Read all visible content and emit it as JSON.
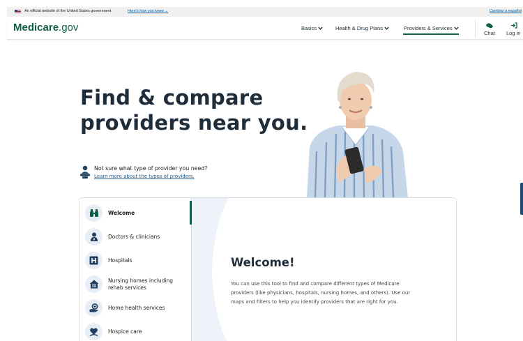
{
  "gov_banner": {
    "official_text": "An official website of the United States government",
    "how_you_know": "Here's how you know",
    "spanish_link": "Cambiar a español"
  },
  "header": {
    "logo_bold": "Medicare",
    "logo_suffix": ".gov",
    "nav": [
      {
        "label": "Basics"
      },
      {
        "label": "Health & Drug Plans"
      },
      {
        "label": "Providers & Services"
      }
    ],
    "chat_label": "Chat",
    "login_label": "Log in"
  },
  "hero": {
    "title_line1": "Find & compare",
    "title_line2": "providers near you."
  },
  "helper": {
    "question": "Not sure what type of provider you need?",
    "link": "Learn more about the types of providers."
  },
  "sidebar": {
    "items": [
      {
        "label": "Welcome",
        "icon": "binoculars-icon"
      },
      {
        "label": "Doctors & clinicians",
        "icon": "doctor-icon"
      },
      {
        "label": "Hospitals",
        "icon": "hospital-icon"
      },
      {
        "label": "Nursing homes including rehab services",
        "icon": "nursing-home-icon"
      },
      {
        "label": "Home health services",
        "icon": "home-health-icon"
      },
      {
        "label": "Hospice care",
        "icon": "hospice-icon"
      }
    ]
  },
  "welcome": {
    "heading": "Welcome!",
    "body": "You can use this tool to find and compare different types of Medicare providers (like physicians, hospitals, nursing homes, and others). Use our maps and filters to help you identify providers that are right for you."
  },
  "colors": {
    "brand_green": "#0f5e43",
    "link_blue": "#2a5f8c",
    "title_dark": "#1f2d3a"
  }
}
